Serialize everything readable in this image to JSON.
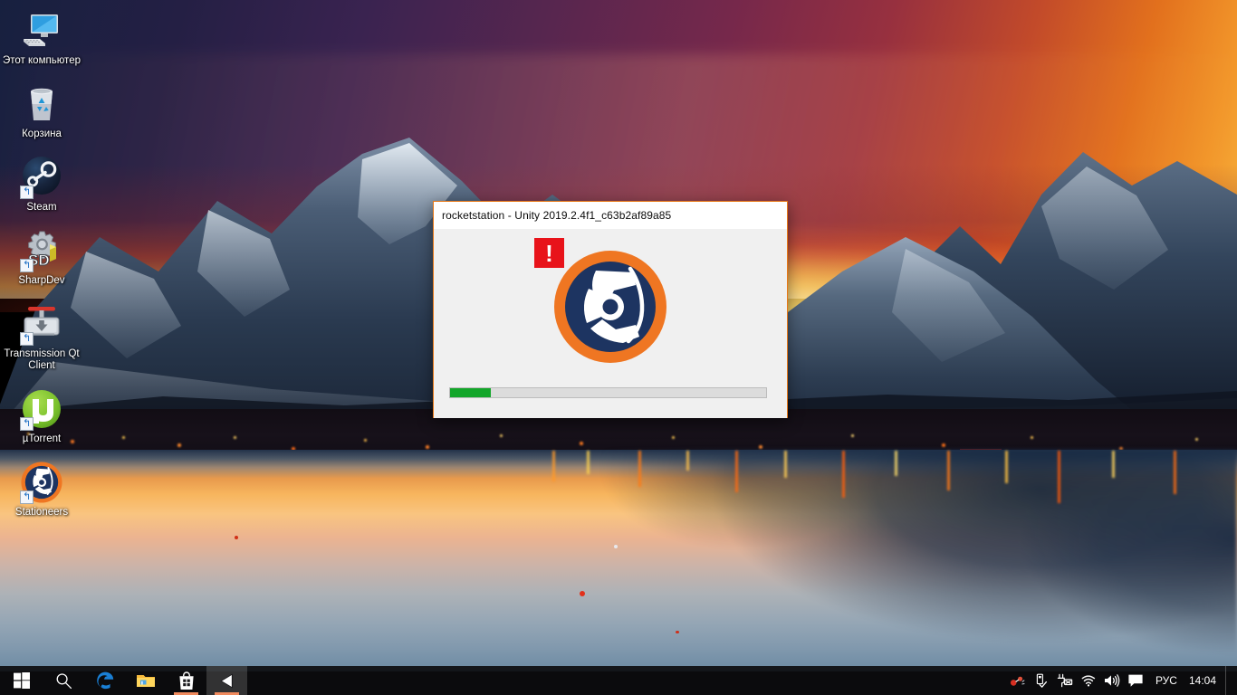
{
  "desktop": {
    "icons": [
      {
        "label": "Этот компьютер",
        "icon": "this-pc-icon",
        "shortcut": false
      },
      {
        "label": "Корзина",
        "icon": "recycle-bin-icon",
        "shortcut": false
      },
      {
        "label": "Steam",
        "icon": "steam-icon",
        "shortcut": true
      },
      {
        "label": "SharpDev",
        "icon": "sharpdev-icon",
        "shortcut": true
      },
      {
        "label": "Transmission Qt Client",
        "icon": "transmission-icon",
        "shortcut": true
      },
      {
        "label": "µTorrent",
        "icon": "utorrent-icon",
        "shortcut": true
      },
      {
        "label": "Stationeers",
        "icon": "stationeers-icon",
        "shortcut": true
      }
    ],
    "wallpaper_name": "reine-lofoten-sunset"
  },
  "splash": {
    "title": "rocketstation - Unity 2019.2.4f1_c63b2af89a85",
    "logo_name": "stationeers-logo",
    "warning_badge": "!",
    "progress_percent": 13,
    "progress_color": "#13a62a",
    "border_color": "#e77817",
    "body_color": "#f0f0f0",
    "logo_ring_color": "#ef7622",
    "logo_disc_color": "#1d3461"
  },
  "taskbar": {
    "start_label": "start-button",
    "buttons": [
      {
        "name": "start-button",
        "icon": "windows-logo-icon",
        "active": false,
        "running": false
      },
      {
        "name": "search-button",
        "icon": "search-icon",
        "active": false,
        "running": false
      },
      {
        "name": "edge-button",
        "icon": "edge-icon",
        "active": false,
        "running": false
      },
      {
        "name": "file-explorer-button",
        "icon": "folder-icon",
        "active": false,
        "running": false
      },
      {
        "name": "microsoft-store-button",
        "icon": "store-icon",
        "active": false,
        "running": true
      },
      {
        "name": "unity-button",
        "icon": "unity-icon",
        "active": true,
        "running": true
      }
    ],
    "tray": [
      {
        "name": "utorrent-tray-icon",
        "icon": "utorrent-tray-icon"
      },
      {
        "name": "safely-remove-hardware-icon",
        "icon": "usb-eject-icon"
      },
      {
        "name": "power-icon",
        "icon": "power-plug-icon"
      },
      {
        "name": "network-icon",
        "icon": "wifi-icon"
      },
      {
        "name": "volume-icon",
        "icon": "speaker-icon"
      },
      {
        "name": "action-center-icon",
        "icon": "notification-icon"
      }
    ],
    "language": "РУС",
    "clock_time": "14:04"
  },
  "colors": {
    "accent_orange": "#e77817",
    "taskbar_bg": "#0c0c0e",
    "progress_green": "#13a62a",
    "warning_red": "#e8131a"
  }
}
